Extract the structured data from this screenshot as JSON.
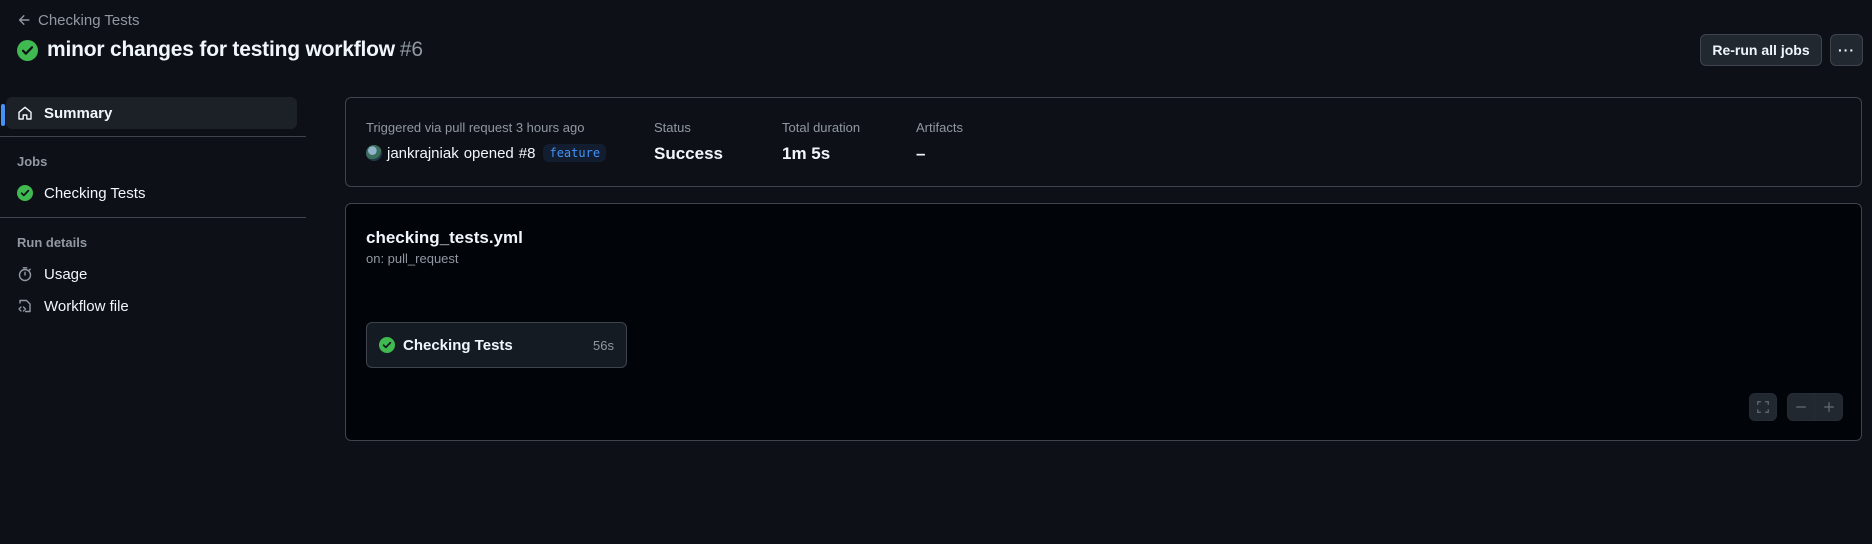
{
  "header": {
    "back_label": "Checking Tests",
    "title": "minor changes for testing workflow",
    "run_number": "#6",
    "rerun_label": "Re-run all jobs",
    "more_label": "···"
  },
  "sidebar": {
    "summary_label": "Summary",
    "jobs_heading": "Jobs",
    "jobs": [
      {
        "label": "Checking Tests",
        "status": "success"
      }
    ],
    "run_details_heading": "Run details",
    "details": [
      {
        "label": "Usage",
        "icon": "stopwatch-icon"
      },
      {
        "label": "Workflow file",
        "icon": "file-code-icon"
      }
    ]
  },
  "summary": {
    "trigger_label": "Triggered via pull request 3 hours ago",
    "actor": "jankrajniak",
    "action": "opened",
    "pr": "#8",
    "branch": "feature",
    "status_label": "Status",
    "status_value": "Success",
    "duration_label": "Total duration",
    "duration_value": "1m 5s",
    "artifacts_label": "Artifacts",
    "artifacts_value": "–"
  },
  "workflow": {
    "file": "checking_tests.yml",
    "on": "on: pull_request",
    "job_name": "Checking Tests",
    "job_duration": "56s"
  },
  "colors": {
    "success": "#3fb950",
    "accent": "#4493f8",
    "background": "#0d1117"
  }
}
